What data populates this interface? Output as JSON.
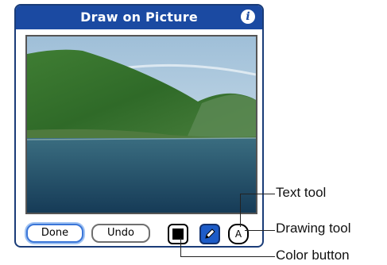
{
  "window": {
    "title": "Draw on Picture",
    "info_icon": "info-icon"
  },
  "toolbar": {
    "done_label": "Done",
    "undo_label": "Undo",
    "color_button_icon": "color-swatch-icon",
    "drawing_tool_icon": "pencil-icon",
    "text_tool_label": "A",
    "selected_color": "#000000",
    "active_tool_color": "#1d5cc8"
  },
  "callouts": {
    "text_tool": "Text tool",
    "drawing_tool": "Drawing tool",
    "color_button": "Color button"
  },
  "colors": {
    "titlebar": "#1b4aa2",
    "frame": "#1a3c78",
    "done_highlight": "#3b76d8"
  }
}
